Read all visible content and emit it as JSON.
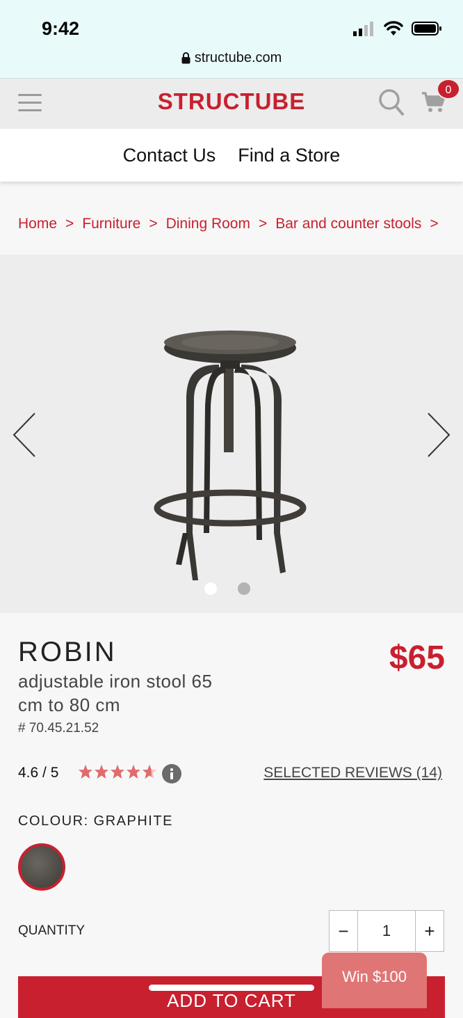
{
  "status_bar": {
    "time": "9:42",
    "url": "structube.com"
  },
  "header": {
    "logo": "STRUCTUBE",
    "cart_count": "0"
  },
  "nav": {
    "contact": "Contact Us",
    "find_store": "Find a Store"
  },
  "breadcrumb": [
    "Home",
    "Furniture",
    "Dining Room",
    "Bar and counter stools"
  ],
  "breadcrumb_separator": ">",
  "gallery": {
    "slides": 2,
    "active_slide": 1
  },
  "product": {
    "name": "ROBIN",
    "description": "adjustable iron stool 65 cm to 80 cm",
    "sku": "# 70.45.21.52",
    "price": "$65",
    "rating": "4.6 / 5",
    "rating_value": 4.6,
    "reviews_link": "SELECTED REVIEWS (14)",
    "colour_label": "COLOUR: GRAPHITE",
    "quantity_label": "QUANTITY",
    "quantity": "1",
    "add_to_cart": "ADD TO CART"
  },
  "promo": {
    "label": "Win $100"
  },
  "colors": {
    "brand": "#c8202f",
    "promo": "#e07575",
    "stars": "#e06b6b"
  }
}
